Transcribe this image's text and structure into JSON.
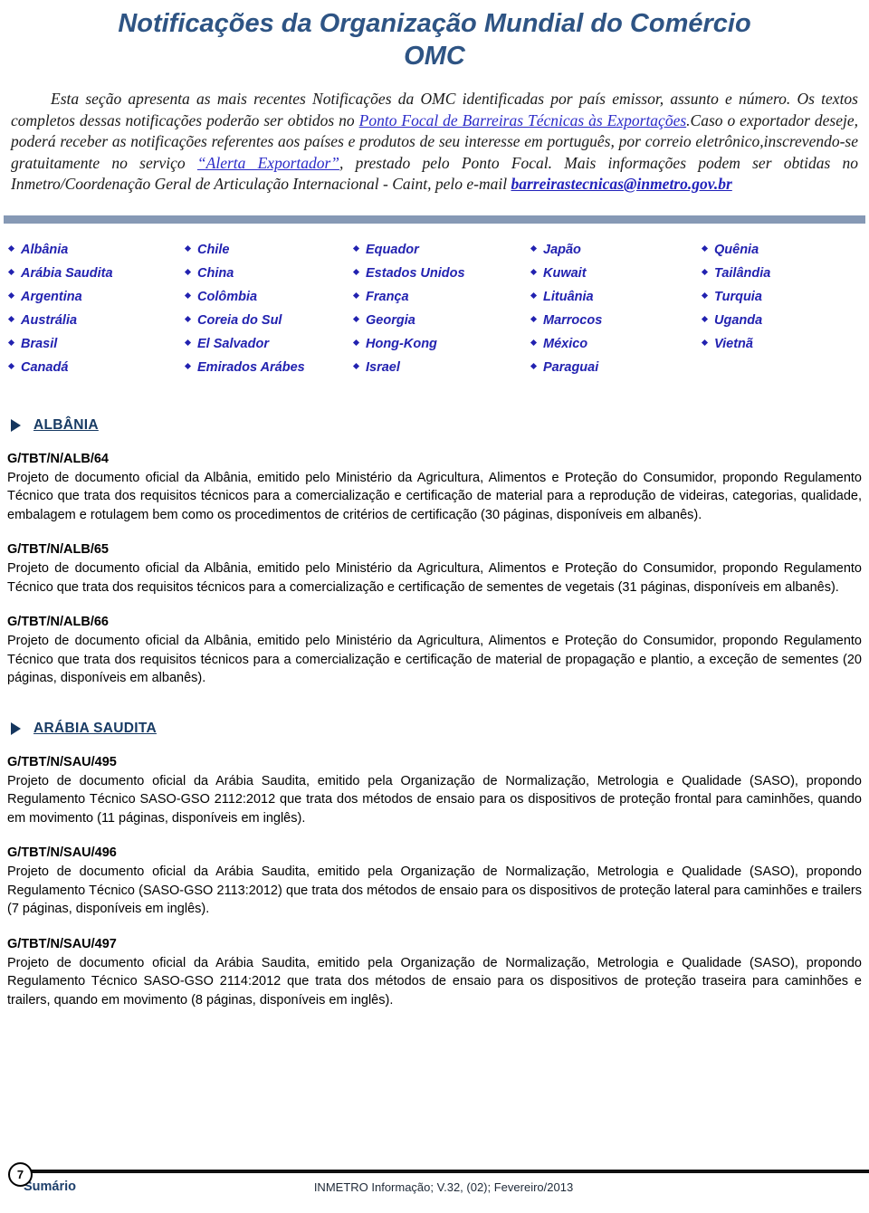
{
  "header": {
    "title_line1": "Notificações da Organização Mundial do Comércio",
    "title_line2": "OMC"
  },
  "intro": {
    "t1": "Esta seção apresenta as mais recentes Notificações da OMC identificadas por país emissor, assunto e número. Os textos completos dessas notificações poderão ser obtidos no ",
    "link1": "Ponto Focal de Barreiras Técnicas às Exportações",
    "t2": ".Caso o exportador deseje, poderá receber as notificações referentes aos países e produtos de seu interesse em português, por correio eletrônico,inscrevendo-se gratuitamente no serviço ",
    "link2": "“Alerta Exportador”",
    "t3": ", prestado pelo Ponto Focal. Mais informações  podem ser obtidas no Inmetro/Coordenação Geral de Articulação Internacional - Caint, pelo e-mail ",
    "email": "barreirastecnicas@inmetro.gov.br"
  },
  "country_columns": [
    [
      "Albânia",
      "Arábia Saudita",
      "Argentina",
      "Austrália",
      "Brasil",
      "Canadá"
    ],
    [
      "Chile",
      "China",
      "Colômbia",
      "Coreia do Sul",
      "El Salvador",
      "Emirados Arábes"
    ],
    [
      "Equador",
      "Estados Unidos",
      "França",
      "Georgia",
      "Hong-Kong",
      "Israel"
    ],
    [
      "Japão",
      "Kuwait",
      "Lituânia",
      "Marrocos",
      "México",
      "Paraguai"
    ],
    [
      "Quênia",
      "Tailândia",
      "Turquia",
      "Uganda",
      "Vietnã"
    ]
  ],
  "sections": [
    {
      "country": "ALBÂNIA",
      "notifications": [
        {
          "code": "G/TBT/N/ALB/64",
          "text": "Projeto de documento oficial da Albânia, emitido pelo Ministério da Agricultura, Alimentos e Proteção do Consumidor, propondo Regulamento Técnico que trata dos requisitos técnicos para a comercialização e certificação de material para a reprodução de videiras, categorias, qualidade, embalagem e rotulagem bem como os procedimentos de critérios de certificação (30 páginas, disponíveis em albanês)."
        },
        {
          "code": "G/TBT/N/ALB/65",
          "text": "Projeto de documento oficial da Albânia, emitido pelo Ministério da Agricultura, Alimentos e Proteção do Consumidor, propondo Regulamento Técnico que trata dos requisitos técnicos para a comercialização e certificação de sementes de vegetais (31 páginas, disponíveis em albanês)."
        },
        {
          "code": "G/TBT/N/ALB/66",
          "text": "Projeto de documento oficial da Albânia, emitido pelo Ministério da Agricultura, Alimentos e Proteção do Consumidor, propondo Regulamento Técnico que trata dos requisitos técnicos para a comercialização e certificação de material de propagação e plantio, a exceção de sementes (20 páginas, disponíveis em albanês)."
        }
      ]
    },
    {
      "country": "ARÁBIA SAUDITA",
      "notifications": [
        {
          "code": "G/TBT/N/SAU/495",
          "text": "Projeto de documento oficial da Arábia Saudita, emitido pela Organização de Normalização, Metrologia e Qualidade (SASO), propondo Regulamento Técnico SASO-GSO 2112:2012 que trata dos métodos de ensaio para os dispositivos de proteção frontal para caminhões, quando em movimento (11 páginas, disponíveis em inglês)."
        },
        {
          "code": "G/TBT/N/SAU/496",
          "text": "Projeto de documento oficial da Arábia Saudita, emitido pela Organização de Normalização, Metrologia e Qualidade (SASO), propondo Regulamento Técnico (SASO-GSO 2113:2012) que trata dos métodos de ensaio para os dispositivos de proteção lateral para caminhões e trailers (7 páginas, disponíveis em inglês)."
        },
        {
          "code": "G/TBT/N/SAU/497",
          "text": "Projeto de documento oficial da Arábia Saudita, emitido pela Organização de Normalização, Metrologia e Qualidade (SASO), propondo Regulamento Técnico SASO-GSO 2114:2012 que trata dos métodos de ensaio para os dispositivos de proteção traseira para caminhões e trailers, quando em movimento (8 páginas, disponíveis em inglês)."
        }
      ]
    }
  ],
  "footer": {
    "page_number": "7",
    "sumario": "Sumário",
    "issue": "INMETRO Informação; V.32, (02); Fevereiro/2013"
  },
  "colors": {
    "title": "#2e5484",
    "link": "#2b2bc8",
    "country": "#2222b0",
    "heading": "#173a63",
    "separator": "#8699b5"
  }
}
